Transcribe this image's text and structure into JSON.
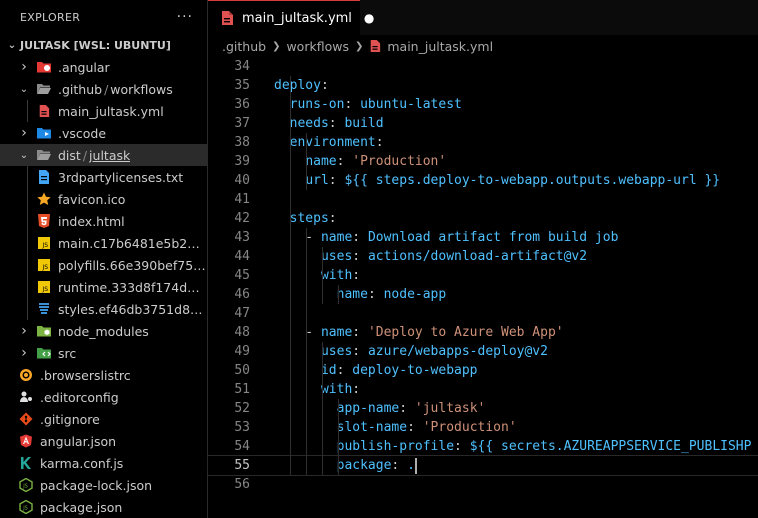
{
  "sidebar": {
    "title": "EXPLORER",
    "more_actions": "···",
    "root_label": "JULTASK [WSL: UBUNTU]",
    "items": [
      {
        "label": ".angular",
        "depth": 0,
        "kind": "folder",
        "icon": "angular-folder-icon"
      },
      {
        "label": ".github",
        "label2": "workflows",
        "depth": 0,
        "kind": "folder-open",
        "icon": "folder-open-icon"
      },
      {
        "label": "main_jultask.yml",
        "depth": 1,
        "kind": "file",
        "icon": "yaml-file-icon"
      },
      {
        "label": ".vscode",
        "depth": 0,
        "kind": "folder",
        "icon": "vscode-folder-icon"
      },
      {
        "label": "dist",
        "label2": "jultask",
        "depth": 0,
        "kind": "folder-open",
        "icon": "folder-open-icon"
      },
      {
        "label": "3rdpartylicenses.txt",
        "depth": 1,
        "kind": "file",
        "icon": "text-file-icon"
      },
      {
        "label": "favicon.ico",
        "depth": 1,
        "kind": "file",
        "icon": "star-icon"
      },
      {
        "label": "index.html",
        "depth": 1,
        "kind": "file",
        "icon": "html-file-icon"
      },
      {
        "label": "main.c17b6481e5b255...",
        "depth": 1,
        "kind": "file",
        "icon": "js-file-icon"
      },
      {
        "label": "polyfills.66e390bef756...",
        "depth": 1,
        "kind": "file",
        "icon": "js-file-icon"
      },
      {
        "label": "runtime.333d8f174da5...",
        "depth": 1,
        "kind": "file",
        "icon": "js-file-icon"
      },
      {
        "label": "styles.ef46db3751d8e9...",
        "depth": 1,
        "kind": "file",
        "icon": "css-file-icon"
      },
      {
        "label": "node_modules",
        "depth": 0,
        "kind": "folder",
        "icon": "node-folder-icon"
      },
      {
        "label": "src",
        "depth": 0,
        "kind": "folder",
        "icon": "src-folder-icon"
      },
      {
        "label": ".browserslistrc",
        "depth": 0,
        "kind": "file",
        "icon": "browserslist-icon"
      },
      {
        "label": ".editorconfig",
        "depth": 0,
        "kind": "file",
        "icon": "editorconfig-icon"
      },
      {
        "label": ".gitignore",
        "depth": 0,
        "kind": "file",
        "icon": "git-icon"
      },
      {
        "label": "angular.json",
        "depth": 0,
        "kind": "file",
        "icon": "angular-icon"
      },
      {
        "label": "karma.conf.js",
        "depth": 0,
        "kind": "file",
        "icon": "karma-icon"
      },
      {
        "label": "package-lock.json",
        "depth": 0,
        "kind": "file",
        "icon": "nodejs-icon"
      },
      {
        "label": "package.json",
        "depth": 0,
        "kind": "file",
        "icon": "nodejs-icon"
      }
    ]
  },
  "editor": {
    "tab": {
      "label": "main_jultask.yml",
      "dirty": "●"
    },
    "breadcrumb": [
      ".github",
      "workflows",
      "main_jultask.yml"
    ],
    "active_line": 55,
    "lines": [
      {
        "n": "34",
        "tokens": []
      },
      {
        "n": "35",
        "tokens": [
          [
            "k",
            "deploy"
          ],
          [
            "p",
            ":"
          ]
        ]
      },
      {
        "n": "36",
        "tokens": [
          [
            "p",
            "  "
          ],
          [
            "k",
            "runs-on"
          ],
          [
            "p",
            ": "
          ],
          [
            "v",
            "ubuntu-latest"
          ]
        ]
      },
      {
        "n": "37",
        "tokens": [
          [
            "p",
            "  "
          ],
          [
            "k",
            "needs"
          ],
          [
            "p",
            ": "
          ],
          [
            "v",
            "build"
          ]
        ]
      },
      {
        "n": "38",
        "tokens": [
          [
            "p",
            "  "
          ],
          [
            "k",
            "environment"
          ],
          [
            "p",
            ":"
          ]
        ]
      },
      {
        "n": "39",
        "tokens": [
          [
            "p",
            "    "
          ],
          [
            "k",
            "name"
          ],
          [
            "p",
            ": "
          ],
          [
            "s",
            "'Production'"
          ]
        ]
      },
      {
        "n": "40",
        "tokens": [
          [
            "p",
            "    "
          ],
          [
            "k",
            "url"
          ],
          [
            "p",
            ": "
          ],
          [
            "v",
            "${{ steps.deploy-to-webapp.outputs.webapp-url }}"
          ]
        ]
      },
      {
        "n": "41",
        "tokens": []
      },
      {
        "n": "42",
        "tokens": [
          [
            "p",
            "  "
          ],
          [
            "k",
            "steps"
          ],
          [
            "p",
            ":"
          ]
        ]
      },
      {
        "n": "43",
        "tokens": [
          [
            "p",
            "    - "
          ],
          [
            "k",
            "name"
          ],
          [
            "p",
            ": "
          ],
          [
            "v",
            "Download artifact from build job"
          ]
        ]
      },
      {
        "n": "44",
        "tokens": [
          [
            "p",
            "      "
          ],
          [
            "k",
            "uses"
          ],
          [
            "p",
            ": "
          ],
          [
            "v",
            "actions/download-artifact@v2"
          ]
        ]
      },
      {
        "n": "45",
        "tokens": [
          [
            "p",
            "      "
          ],
          [
            "k",
            "with"
          ],
          [
            "p",
            ":"
          ]
        ]
      },
      {
        "n": "46",
        "tokens": [
          [
            "p",
            "        "
          ],
          [
            "k",
            "name"
          ],
          [
            "p",
            ": "
          ],
          [
            "v",
            "node-app"
          ]
        ]
      },
      {
        "n": "47",
        "tokens": []
      },
      {
        "n": "48",
        "tokens": [
          [
            "p",
            "    - "
          ],
          [
            "k",
            "name"
          ],
          [
            "p",
            ": "
          ],
          [
            "s",
            "'Deploy to Azure Web App'"
          ]
        ]
      },
      {
        "n": "49",
        "tokens": [
          [
            "p",
            "      "
          ],
          [
            "k",
            "uses"
          ],
          [
            "p",
            ": "
          ],
          [
            "v",
            "azure/webapps-deploy@v2"
          ]
        ]
      },
      {
        "n": "50",
        "tokens": [
          [
            "p",
            "      "
          ],
          [
            "k",
            "id"
          ],
          [
            "p",
            ": "
          ],
          [
            "v",
            "deploy-to-webapp"
          ]
        ]
      },
      {
        "n": "51",
        "tokens": [
          [
            "p",
            "      "
          ],
          [
            "k",
            "with"
          ],
          [
            "p",
            ":"
          ]
        ]
      },
      {
        "n": "52",
        "tokens": [
          [
            "p",
            "        "
          ],
          [
            "k",
            "app-name"
          ],
          [
            "p",
            ": "
          ],
          [
            "s",
            "'jultask'"
          ]
        ]
      },
      {
        "n": "53",
        "tokens": [
          [
            "p",
            "        "
          ],
          [
            "k",
            "slot-name"
          ],
          [
            "p",
            ": "
          ],
          [
            "s",
            "'Production'"
          ]
        ]
      },
      {
        "n": "54",
        "tokens": [
          [
            "p",
            "        "
          ],
          [
            "k",
            "publish-profile"
          ],
          [
            "p",
            ": "
          ],
          [
            "v",
            "${{ secrets.AZUREAPPSERVICE_PUBLISHP"
          ]
        ]
      },
      {
        "n": "55",
        "tokens": [
          [
            "p",
            "        "
          ],
          [
            "k",
            "package"
          ],
          [
            "p",
            ": "
          ],
          [
            "v",
            "."
          ]
        ]
      },
      {
        "n": "56",
        "tokens": []
      }
    ]
  },
  "colors": {
    "key": "#4fc1ff",
    "string": "#ce9178",
    "yaml_icon": "#e05252",
    "js_icon": "#f0c808",
    "css_icon": "#42a5f5",
    "html_icon": "#e44d26",
    "folder_icon": "#8b8b8b",
    "tab_accent": "#d63c3c"
  }
}
